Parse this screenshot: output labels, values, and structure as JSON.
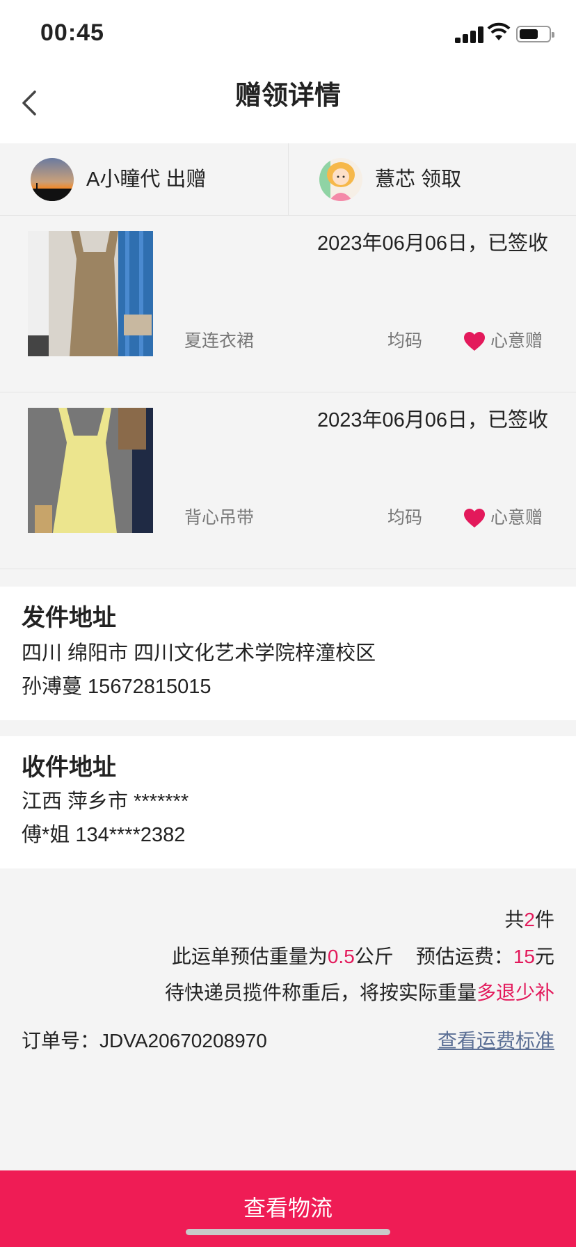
{
  "status_bar": {
    "time": "00:45"
  },
  "nav": {
    "title": "赠领详情"
  },
  "users": {
    "giver": {
      "name": "A小瞳代",
      "action": "出赠"
    },
    "receiver": {
      "name": "薏芯",
      "action": "领取"
    }
  },
  "items": [
    {
      "date_status": "2023年06月06日，已签收",
      "name": "夏连衣裙",
      "size": "均码",
      "tag": "心意赠",
      "image": "khaki-overall-dress-photo"
    },
    {
      "date_status": "2023年06月06日，已签收",
      "name": "背心吊带",
      "size": "均码",
      "tag": "心意赠",
      "image": "yellow-camisole-photo"
    }
  ],
  "sender_address": {
    "title": "发件地址",
    "line1": "四川 绵阳市 四川文化艺术学院梓潼校区",
    "line2": "孙溥蔓 15672815015"
  },
  "receiver_address": {
    "title": "收件地址",
    "line1": "江西 萍乡市 *******",
    "line2": "傅*姐 134****2382"
  },
  "summary": {
    "count_prefix": "共",
    "count": "2",
    "count_suffix": "件",
    "weight_prefix": "此运单预估重量为",
    "weight": "0.5",
    "weight_unit": "公斤",
    "fee_prefix": "预估运费：",
    "fee": "15",
    "fee_unit": "元",
    "note_prefix": "待快递员揽件称重后，将按实际重量",
    "note_highlight": "多退少补"
  },
  "order": {
    "label": "订单号：",
    "number": "JDVA20670208970",
    "fee_link": "查看运费标准"
  },
  "bottom": {
    "button_label": "查看物流"
  },
  "colors": {
    "accent": "#ef1c55",
    "highlight_text": "#e3195b",
    "link": "#5b6f95"
  }
}
